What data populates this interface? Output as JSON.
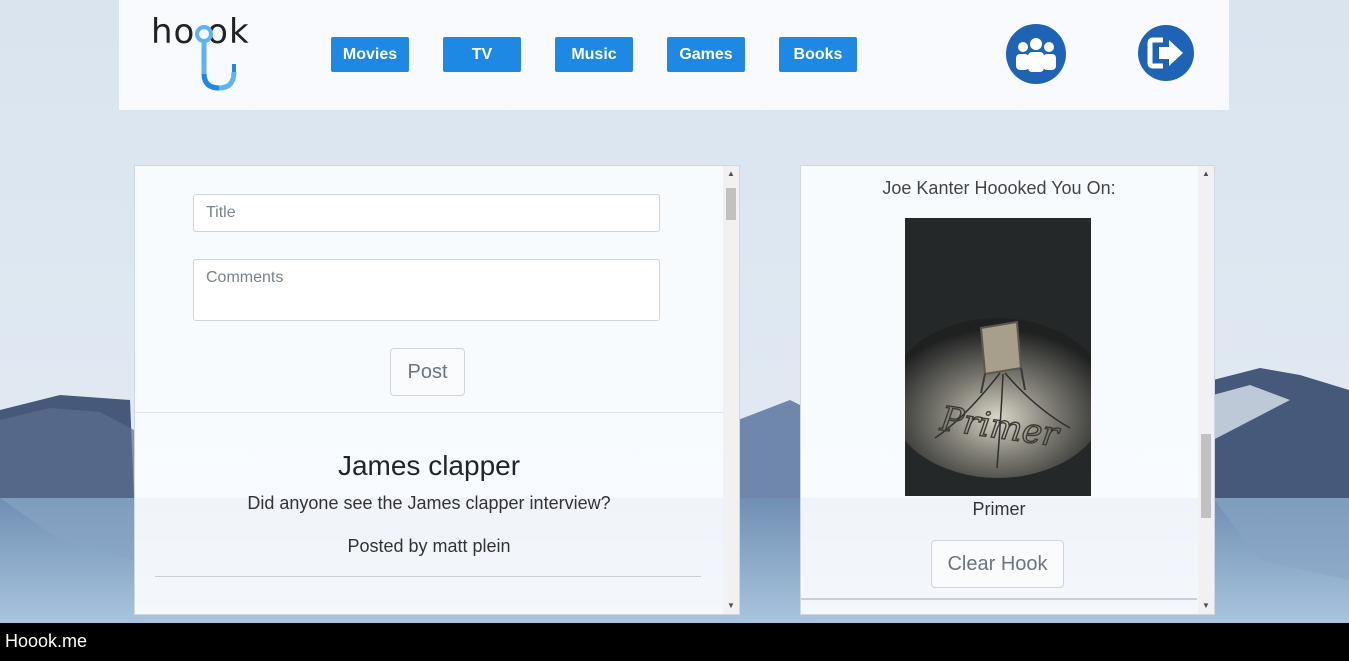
{
  "brand": {
    "logo_text": "ho  ok"
  },
  "nav": {
    "items": [
      {
        "label": "Movies"
      },
      {
        "label": "TV"
      },
      {
        "label": "Music"
      },
      {
        "label": "Games"
      },
      {
        "label": "Books"
      }
    ],
    "friends_icon": "group-icon",
    "logout_icon": "logout-icon"
  },
  "post_form": {
    "title_placeholder": "Title",
    "comments_placeholder": "Comments",
    "post_label": "Post"
  },
  "feed": {
    "posts": [
      {
        "title": "James clapper",
        "body": "Did anyone see the James clapper interview?",
        "author": "Posted by matt plein"
      }
    ]
  },
  "hook": {
    "heading": "Joe Kanter Hoooked You On:",
    "poster_text": "Primer",
    "item_title": "Primer",
    "clear_label": "Clear Hook"
  },
  "footer": {
    "text": "Hoook.me"
  },
  "colors": {
    "accent": "#1e88e5",
    "icon_blue": "#1f63b5",
    "footer_bg": "#000000"
  }
}
